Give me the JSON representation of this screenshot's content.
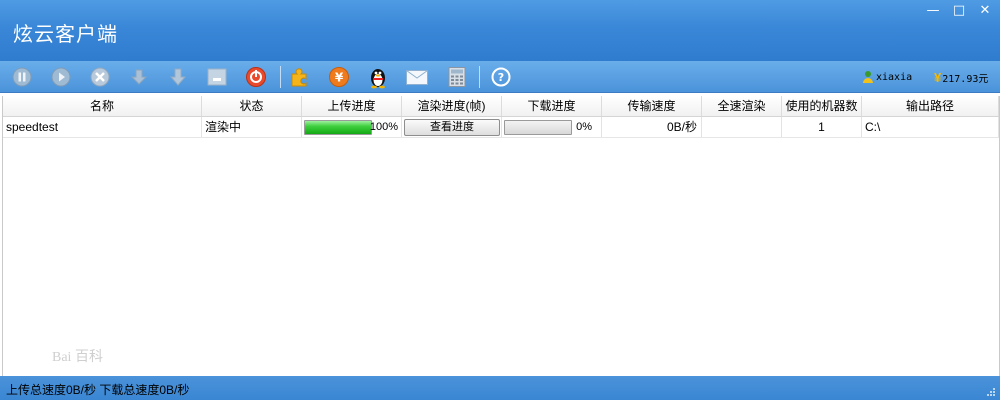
{
  "window": {
    "title": "炫云客户端",
    "controls": {
      "minimize": "—",
      "maximize": "□",
      "close": "✕"
    }
  },
  "toolbar": {
    "buttons": [
      {
        "icon": "pause-icon",
        "enabled": false
      },
      {
        "icon": "play-icon",
        "enabled": false
      },
      {
        "icon": "delete-icon",
        "enabled": false
      },
      {
        "icon": "upload-hand-icon",
        "enabled": false
      },
      {
        "icon": "download-arrow-icon",
        "enabled": false
      },
      {
        "icon": "add-box-icon",
        "enabled": false
      },
      {
        "icon": "power-icon",
        "enabled": true
      },
      {
        "icon": "puzzle-plugin-icon",
        "enabled": true
      },
      {
        "icon": "yen-recharge-icon",
        "enabled": true
      },
      {
        "icon": "qq-penguin-icon",
        "enabled": true
      },
      {
        "icon": "mail-icon",
        "enabled": true
      },
      {
        "icon": "calculator-icon",
        "enabled": true
      },
      {
        "icon": "help-icon",
        "enabled": true
      }
    ],
    "user": {
      "name": "xiaxia"
    },
    "balance": {
      "currency_symbol": "¥",
      "amount": "217.93元"
    }
  },
  "table": {
    "headers": [
      "名称",
      "状态",
      "上传进度",
      "渲染进度(帧)",
      "下载进度",
      "传输速度",
      "全速渲染",
      "使用的机器数",
      "输出路径"
    ],
    "rows": [
      {
        "name": "speedtest",
        "status": "渲染中",
        "upload_progress": 100,
        "upload_text": "100%",
        "render_button": "查看进度",
        "download_progress": 0,
        "download_text": "0%",
        "speed": "0B/秒",
        "full_speed": "",
        "machines": "1",
        "output_path": "C:\\"
      }
    ]
  },
  "statusbar": {
    "text": "上传总速度0B/秒   下载总速度0B/秒"
  },
  "watermark": {
    "text": "Bai 百科"
  },
  "colors": {
    "title_bar": "#3a87d8",
    "toolbar": "#5aa0e2",
    "progress_fill": "#3fcf3f",
    "statusbar": "#4b93da"
  }
}
